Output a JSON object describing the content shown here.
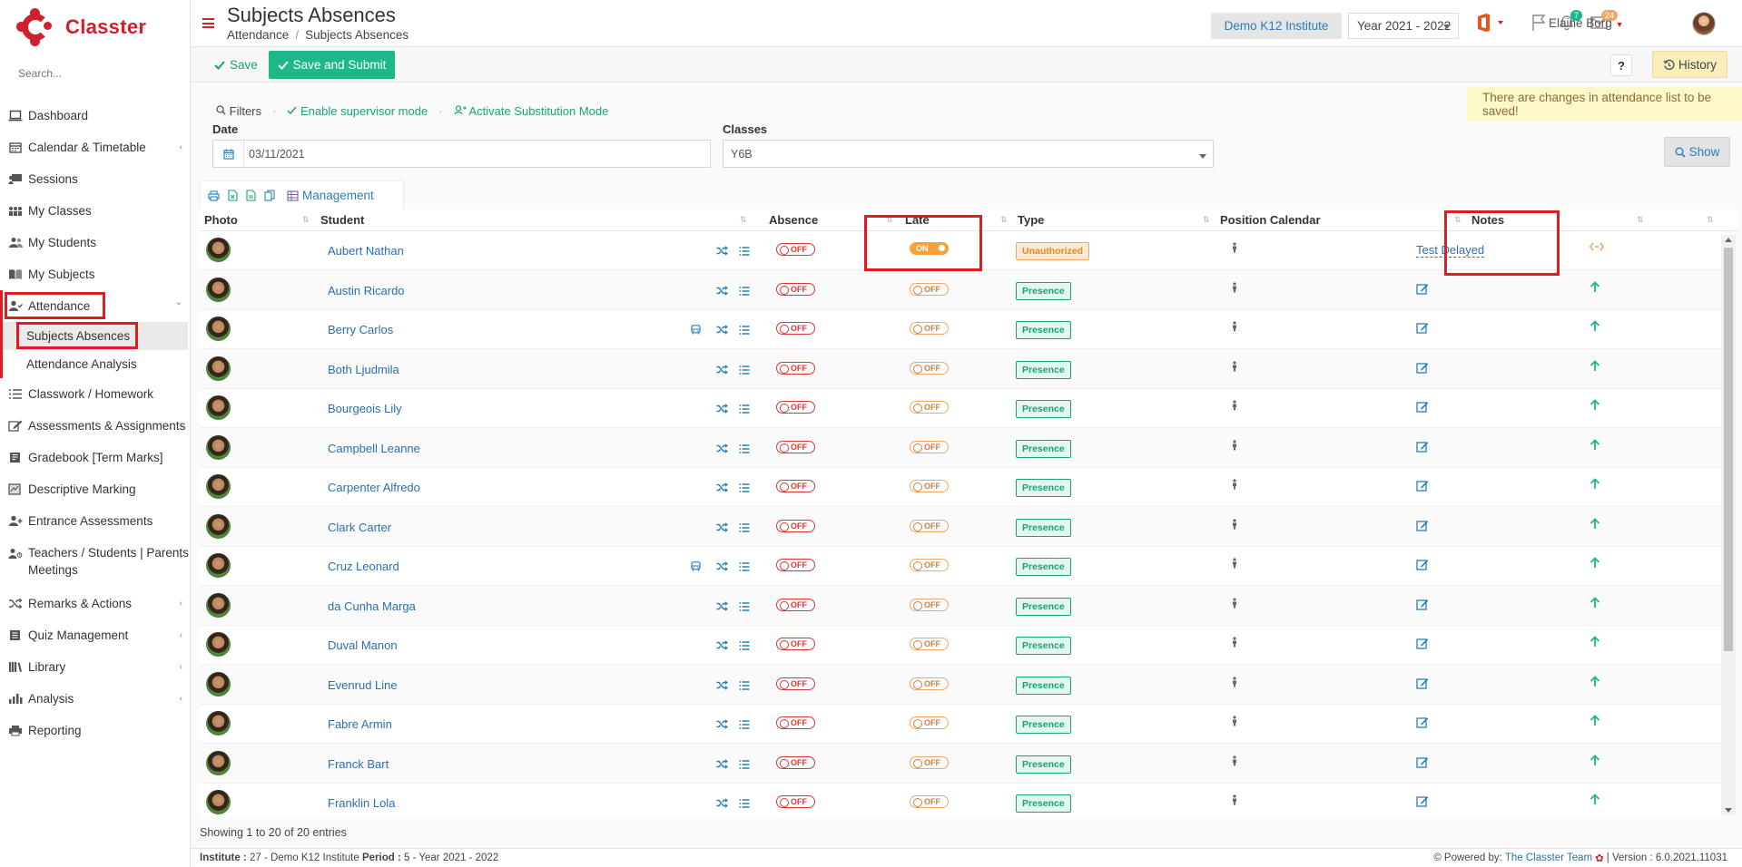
{
  "brand": {
    "name": "Classter"
  },
  "sidebar": {
    "search_placeholder": "Search...",
    "items": [
      {
        "label": "Dashboard",
        "icon": "laptop-icon",
        "chevron": false
      },
      {
        "label": "Calendar & Timetable",
        "icon": "calendar-icon",
        "chevron": true
      },
      {
        "label": "Sessions",
        "icon": "presentation-icon",
        "chevron": false
      },
      {
        "label": "My Classes",
        "icon": "group-icon",
        "chevron": false
      },
      {
        "label": "My Students",
        "icon": "users-icon",
        "chevron": false
      },
      {
        "label": "My Subjects",
        "icon": "book-icon",
        "chevron": false
      },
      {
        "label": "Attendance",
        "icon": "user-check-icon",
        "chevron": true
      },
      {
        "label": "Classwork / Homework",
        "icon": "tasks-icon",
        "chevron": false
      },
      {
        "label": "Assessments & Assignments",
        "icon": "edit-icon",
        "chevron": true
      },
      {
        "label": "Gradebook [Term Marks]",
        "icon": "gradebook-icon",
        "chevron": false
      },
      {
        "label": "Descriptive Marking",
        "icon": "marking-icon",
        "chevron": false
      },
      {
        "label": "Entrance Assessments",
        "icon": "user-plus-icon",
        "chevron": false
      },
      {
        "label": "Teachers / Students | Parents Meetings",
        "icon": "meeting-icon",
        "chevron": true
      },
      {
        "label": "Remarks & Actions",
        "icon": "shuffle-icon",
        "chevron": true
      },
      {
        "label": "Quiz Management",
        "icon": "quiz-icon",
        "chevron": true
      },
      {
        "label": "Library",
        "icon": "library-icon",
        "chevron": true
      },
      {
        "label": "Analysis",
        "icon": "bar-chart-icon",
        "chevron": true
      },
      {
        "label": "Reporting",
        "icon": "print-icon",
        "chevron": false
      }
    ],
    "attendance_sub": [
      "Subjects Absences",
      "Attendance Analysis"
    ]
  },
  "header": {
    "title": "Subjects Absences",
    "breadcrumb": [
      "Attendance",
      "Subjects Absences"
    ],
    "institute": "Demo K12 Institute",
    "year": "Year 2021 - 2022",
    "notifications_count": "7",
    "messages_count": "24",
    "user": "Elaine Borg"
  },
  "actions": {
    "save": "Save",
    "save_submit": "Save and Submit",
    "help": "?",
    "history": "History"
  },
  "warning": "There are changes in attendance list to be saved!",
  "filters": {
    "label": "Filters",
    "supervisor": "Enable supervisor mode",
    "substitution": "Activate Substitution Mode",
    "date_label": "Date",
    "date_value": "03/11/2021",
    "classes_label": "Classes",
    "classes_value": "Y6B",
    "show": "Show"
  },
  "toolbar": {
    "management": "Management"
  },
  "table": {
    "columns": {
      "photo": "Photo",
      "student": "Student",
      "absence": "Absence",
      "late": "Late",
      "type": "Type",
      "position": "Position Calendar",
      "notes": "Notes"
    },
    "off_label": "OFF",
    "on_label": "ON",
    "rows": [
      {
        "name": "Aubert Nathan",
        "bus": false,
        "late": true,
        "type": "Unauthorized",
        "note": "Test Delayed"
      },
      {
        "name": "Austin Ricardo",
        "bus": false,
        "late": false,
        "type": "Presence",
        "note": ""
      },
      {
        "name": "Berry Carlos",
        "bus": true,
        "late": false,
        "type": "Presence",
        "note": ""
      },
      {
        "name": "Both Ljudmila",
        "bus": false,
        "late": false,
        "type": "Presence",
        "note": ""
      },
      {
        "name": "Bourgeois Lily",
        "bus": false,
        "late": false,
        "type": "Presence",
        "note": ""
      },
      {
        "name": "Campbell Leanne",
        "bus": false,
        "late": false,
        "type": "Presence",
        "note": ""
      },
      {
        "name": "Carpenter Alfredo",
        "bus": false,
        "late": false,
        "type": "Presence",
        "note": ""
      },
      {
        "name": "Clark Carter",
        "bus": false,
        "late": false,
        "type": "Presence",
        "note": ""
      },
      {
        "name": "Cruz Leonard",
        "bus": true,
        "late": false,
        "type": "Presence",
        "note": ""
      },
      {
        "name": "da Cunha Marga",
        "bus": false,
        "late": false,
        "type": "Presence",
        "note": ""
      },
      {
        "name": "Duval Manon",
        "bus": false,
        "late": false,
        "type": "Presence",
        "note": ""
      },
      {
        "name": "Evenrud Line",
        "bus": false,
        "late": false,
        "type": "Presence",
        "note": ""
      },
      {
        "name": "Fabre Armin",
        "bus": false,
        "late": false,
        "type": "Presence",
        "note": ""
      },
      {
        "name": "Franck Bart",
        "bus": false,
        "late": false,
        "type": "Presence",
        "note": ""
      },
      {
        "name": "Franklin Lola",
        "bus": false,
        "late": false,
        "type": "Presence",
        "note": ""
      }
    ],
    "showing": "Showing 1 to 20 of 20 entries"
  },
  "footer": {
    "institute_label": "Institute :",
    "institute_value": "27 - Demo K12 Institute",
    "period_label": "Period :",
    "period_value": "5 - Year 2021 - 2022",
    "powered": "Powered by:",
    "team": "The Classter Team",
    "version": "| Version : 6.0.2021.11031"
  },
  "colors": {
    "brand": "#d0202e",
    "accent": "#1cb88a",
    "link": "#2a6fb0",
    "highlight": "#e01b24"
  }
}
